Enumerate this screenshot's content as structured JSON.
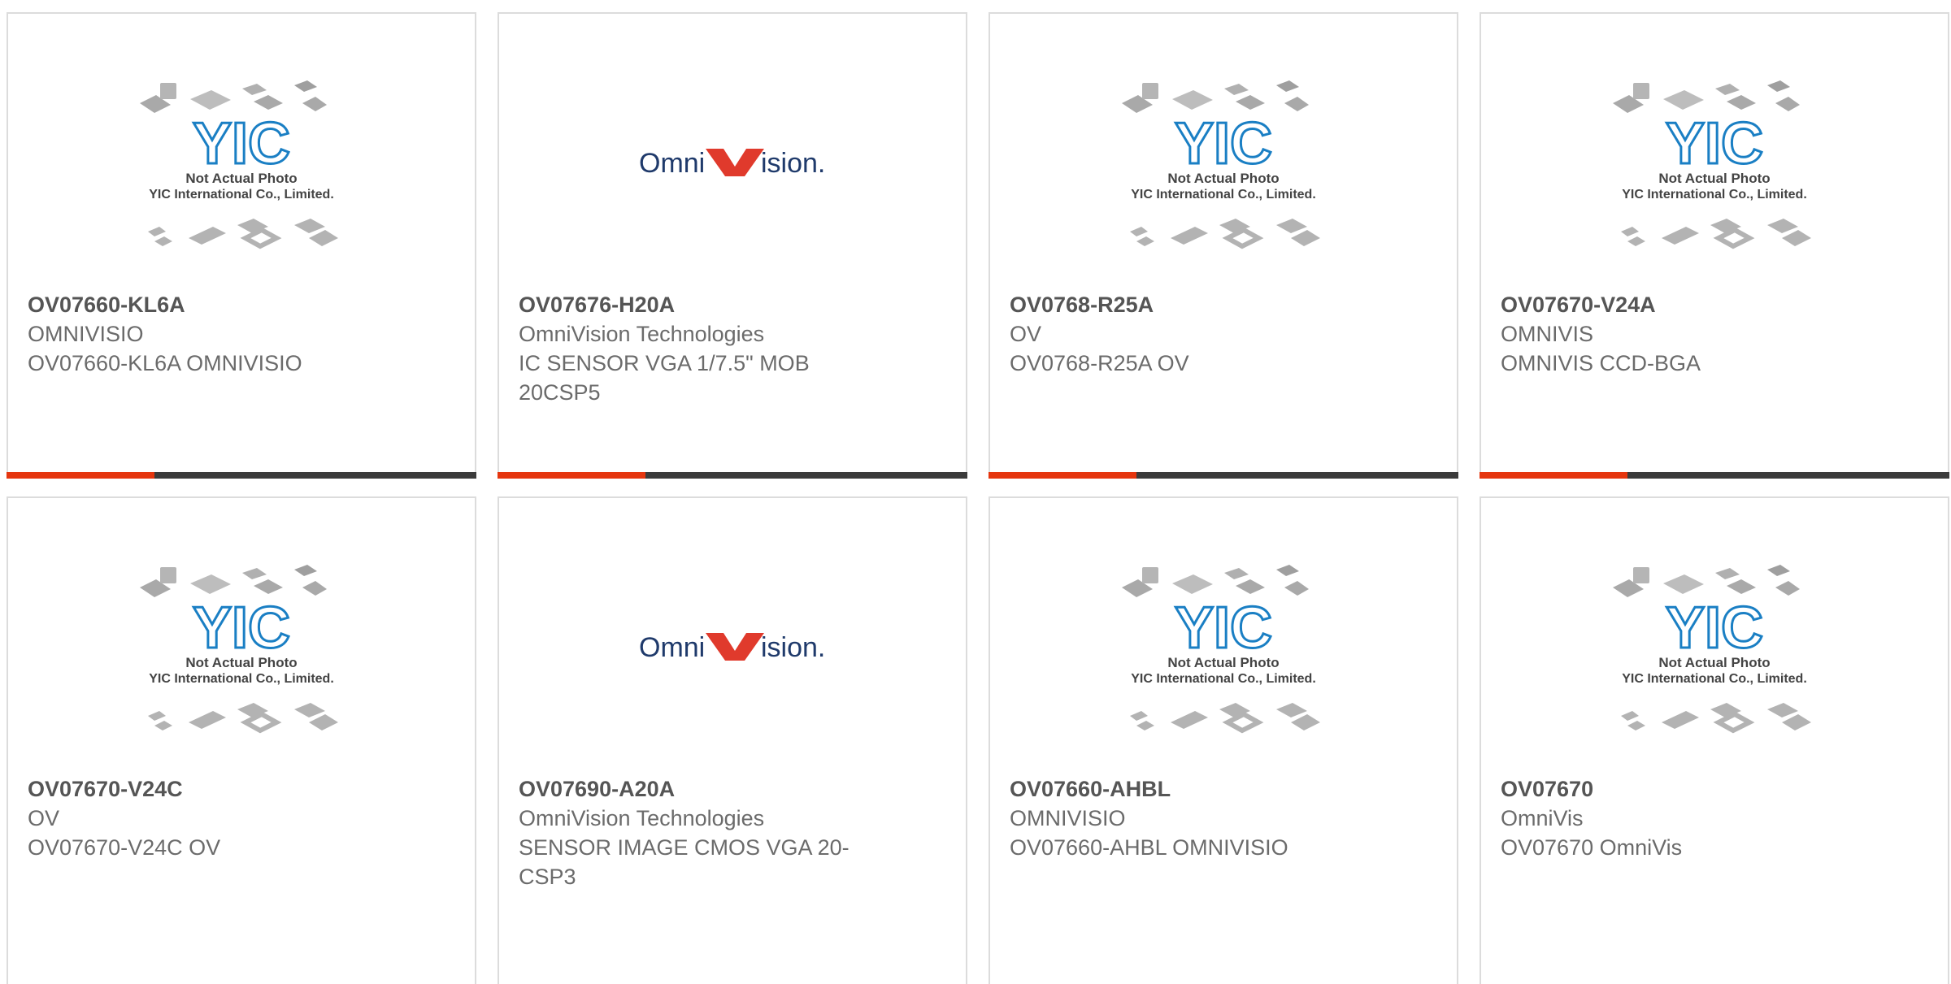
{
  "placeholder_image": {
    "line1": "Not Actual Photo",
    "line2": "YIC International Co., Limited.",
    "logo_text": "YIC"
  },
  "omnivision_logo": {
    "left": "Omni",
    "right": "ision."
  },
  "products": [
    {
      "part": "OV07660-KL6A",
      "maker": "OMNIVISIO",
      "desc": "OV07660-KL6A OMNIVISIO",
      "image": "placeholder"
    },
    {
      "part": "OV07676-H20A",
      "maker": "OmniVision Technologies",
      "desc": "IC SENSOR VGA 1/7.5\" MOB 20CSP5",
      "image": "omnivision"
    },
    {
      "part": "OV0768-R25A",
      "maker": "OV",
      "desc": "OV0768-R25A OV",
      "image": "placeholder"
    },
    {
      "part": "OV07670-V24A",
      "maker": "OMNIVIS",
      "desc": "OMNIVIS CCD-BGA",
      "image": "placeholder"
    },
    {
      "part": "OV07670-V24C",
      "maker": "OV",
      "desc": "OV07670-V24C OV",
      "image": "placeholder"
    },
    {
      "part": "OV07690-A20A",
      "maker": "OmniVision Technologies",
      "desc": "SENSOR IMAGE CMOS VGA 20-CSP3",
      "image": "omnivision"
    },
    {
      "part": "OV07660-AHBL",
      "maker": "OMNIVISIO",
      "desc": "OV07660-AHBL OMNIVISIO",
      "image": "placeholder"
    },
    {
      "part": "OV07670",
      "maker": "OmniVis",
      "desc": "OV07670 OmniVis",
      "image": "placeholder"
    }
  ],
  "colors": {
    "accent": "#e5360f",
    "bar": "#3b3b3b",
    "yic_blue": "#1a7fc4",
    "omni_navy": "#1f3a6b",
    "omni_red": "#e03a2c"
  }
}
